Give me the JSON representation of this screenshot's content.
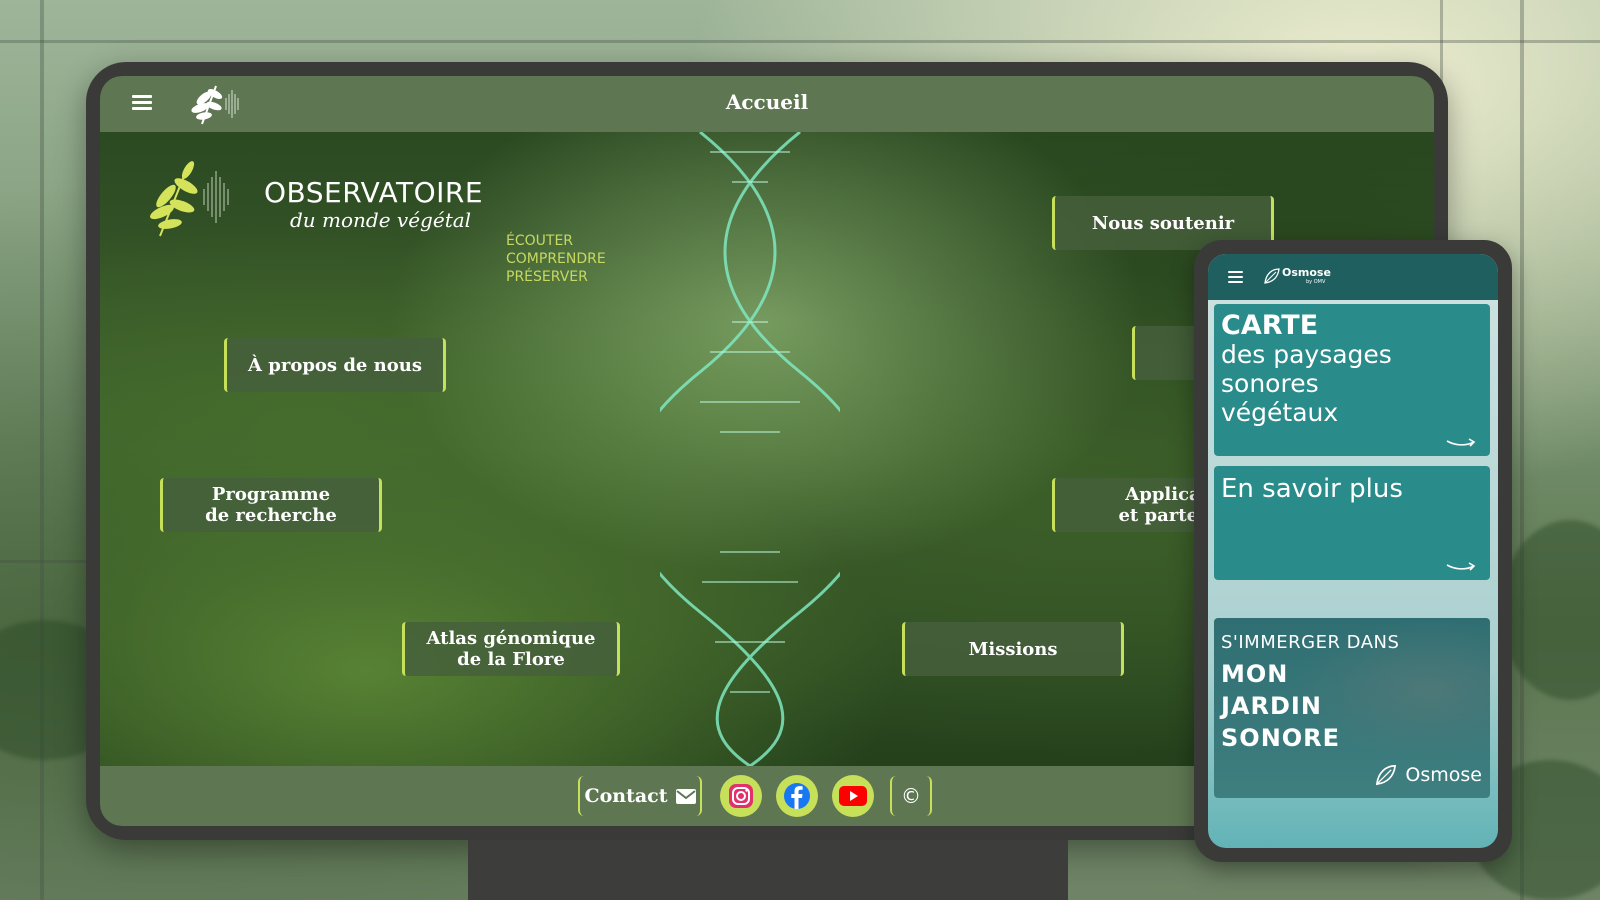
{
  "colors": {
    "accent": "#c6e05a",
    "bar": "#5e7752",
    "teal_card": "#2a8c8a",
    "phone_header": "#1f5f5f"
  },
  "desktop": {
    "header": {
      "title": "Accueil",
      "menu_icon": "hamburger-icon",
      "logo_icon": "leaf-logo-icon"
    },
    "brand": {
      "line1": "OBSERVATOIRE",
      "line2": "du monde végétal"
    },
    "tagline": [
      "ÉCOUTER",
      "COMPRENDRE",
      "PRÉSERVER"
    ],
    "nav": {
      "about": "À propos de nous",
      "research_1": "Programme",
      "research_2": "de recherche",
      "atlas_1": "Atlas génomique",
      "atlas_2": "de la Flore",
      "missions": "Missions",
      "support": "Nous soutenir",
      "apps_1": "Applica",
      "apps_2": "et parter"
    },
    "footer": {
      "contact": "Contact",
      "social": [
        "instagram-icon",
        "facebook-icon",
        "youtube-icon"
      ],
      "copyright": "©"
    }
  },
  "mobile": {
    "header": {
      "menu_icon": "hamburger-icon",
      "app_name": "Osmose",
      "app_by": "by OMV"
    },
    "card1": {
      "title": "CARTE",
      "lines": [
        "des paysages",
        "sonores",
        "végétaux"
      ]
    },
    "card2": {
      "title": "En savoir plus"
    },
    "card3": {
      "kicker": "S'IMMERGER DANS",
      "lines": [
        "MON",
        "JARDIN",
        "SONORE"
      ],
      "brand": "Osmose"
    }
  }
}
